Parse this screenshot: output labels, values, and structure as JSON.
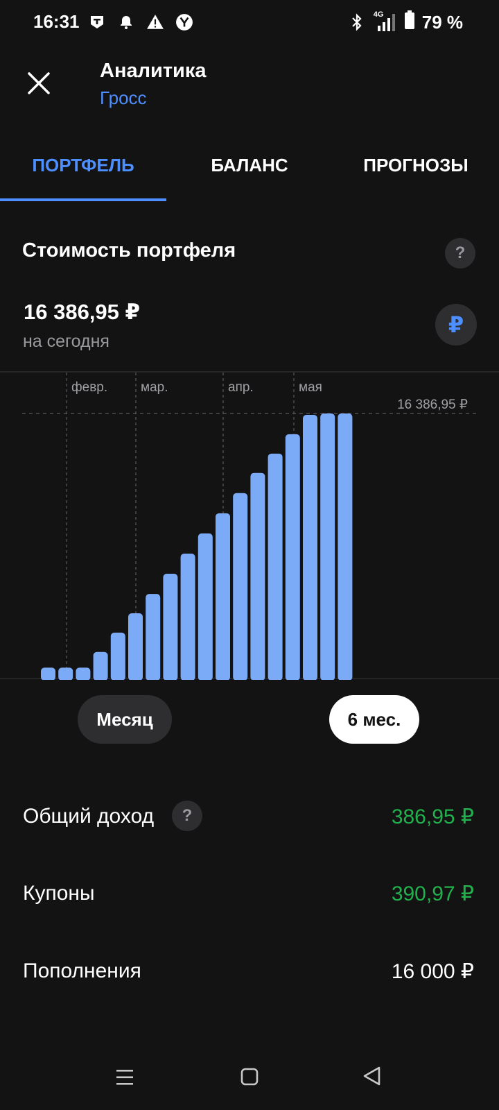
{
  "status": {
    "time": "16:31",
    "battery": "79 %",
    "network": "4G"
  },
  "header": {
    "title": "Аналитика",
    "subtitle": "Гросс"
  },
  "tabs": [
    {
      "label": "ПОРТФЕЛЬ",
      "active": true
    },
    {
      "label": "БАЛАНС",
      "active": false
    },
    {
      "label": "ПРОГНОЗЫ",
      "active": false
    }
  ],
  "portfolio": {
    "title": "Стоимость портфеля",
    "help": "?",
    "value": "16 386,95 ₽",
    "value_caption": "на сегодня",
    "currency_symbol": "₽"
  },
  "chart_data": {
    "type": "bar",
    "x_ticks": [
      "февр.",
      "мар.",
      "апр.",
      "мая"
    ],
    "reference_label": "16 386,95 ₽",
    "reference_value": 16386.95,
    "values": [
      630,
      630,
      630,
      1600,
      2800,
      4000,
      5200,
      6450,
      7700,
      8950,
      10200,
      11450,
      12700,
      13900,
      15100,
      16300,
      16386.95,
      16386.95
    ],
    "ylim": [
      0,
      16386.95
    ],
    "bar_color": "#7baaf7"
  },
  "periods": {
    "month": "Месяц",
    "six_months": "6 мес."
  },
  "summary": [
    {
      "label": "Общий доход",
      "value": "386,95 ₽",
      "help": "?",
      "positive": true
    },
    {
      "label": "Купоны",
      "value": "390,97 ₽",
      "positive": true
    },
    {
      "label": "Пополнения",
      "value": "16 000 ₽",
      "positive": false
    }
  ],
  "colors": {
    "accent": "#4e8fff",
    "positive": "#21b04b",
    "background": "#131314"
  }
}
